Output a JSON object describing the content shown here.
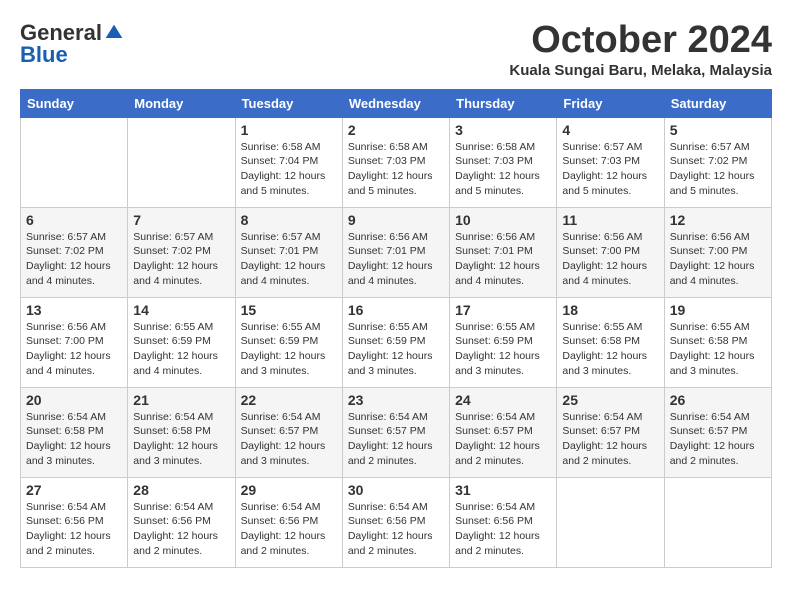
{
  "logo": {
    "general": "General",
    "blue": "Blue"
  },
  "title": "October 2024",
  "subtitle": "Kuala Sungai Baru, Melaka, Malaysia",
  "days_of_week": [
    "Sunday",
    "Monday",
    "Tuesday",
    "Wednesday",
    "Thursday",
    "Friday",
    "Saturday"
  ],
  "weeks": [
    [
      {
        "day": "",
        "detail": ""
      },
      {
        "day": "",
        "detail": ""
      },
      {
        "day": "1",
        "detail": "Sunrise: 6:58 AM\nSunset: 7:04 PM\nDaylight: 12 hours\nand 5 minutes."
      },
      {
        "day": "2",
        "detail": "Sunrise: 6:58 AM\nSunset: 7:03 PM\nDaylight: 12 hours\nand 5 minutes."
      },
      {
        "day": "3",
        "detail": "Sunrise: 6:58 AM\nSunset: 7:03 PM\nDaylight: 12 hours\nand 5 minutes."
      },
      {
        "day": "4",
        "detail": "Sunrise: 6:57 AM\nSunset: 7:03 PM\nDaylight: 12 hours\nand 5 minutes."
      },
      {
        "day": "5",
        "detail": "Sunrise: 6:57 AM\nSunset: 7:02 PM\nDaylight: 12 hours\nand 5 minutes."
      }
    ],
    [
      {
        "day": "6",
        "detail": "Sunrise: 6:57 AM\nSunset: 7:02 PM\nDaylight: 12 hours\nand 4 minutes."
      },
      {
        "day": "7",
        "detail": "Sunrise: 6:57 AM\nSunset: 7:02 PM\nDaylight: 12 hours\nand 4 minutes."
      },
      {
        "day": "8",
        "detail": "Sunrise: 6:57 AM\nSunset: 7:01 PM\nDaylight: 12 hours\nand 4 minutes."
      },
      {
        "day": "9",
        "detail": "Sunrise: 6:56 AM\nSunset: 7:01 PM\nDaylight: 12 hours\nand 4 minutes."
      },
      {
        "day": "10",
        "detail": "Sunrise: 6:56 AM\nSunset: 7:01 PM\nDaylight: 12 hours\nand 4 minutes."
      },
      {
        "day": "11",
        "detail": "Sunrise: 6:56 AM\nSunset: 7:00 PM\nDaylight: 12 hours\nand 4 minutes."
      },
      {
        "day": "12",
        "detail": "Sunrise: 6:56 AM\nSunset: 7:00 PM\nDaylight: 12 hours\nand 4 minutes."
      }
    ],
    [
      {
        "day": "13",
        "detail": "Sunrise: 6:56 AM\nSunset: 7:00 PM\nDaylight: 12 hours\nand 4 minutes."
      },
      {
        "day": "14",
        "detail": "Sunrise: 6:55 AM\nSunset: 6:59 PM\nDaylight: 12 hours\nand 4 minutes."
      },
      {
        "day": "15",
        "detail": "Sunrise: 6:55 AM\nSunset: 6:59 PM\nDaylight: 12 hours\nand 3 minutes."
      },
      {
        "day": "16",
        "detail": "Sunrise: 6:55 AM\nSunset: 6:59 PM\nDaylight: 12 hours\nand 3 minutes."
      },
      {
        "day": "17",
        "detail": "Sunrise: 6:55 AM\nSunset: 6:59 PM\nDaylight: 12 hours\nand 3 minutes."
      },
      {
        "day": "18",
        "detail": "Sunrise: 6:55 AM\nSunset: 6:58 PM\nDaylight: 12 hours\nand 3 minutes."
      },
      {
        "day": "19",
        "detail": "Sunrise: 6:55 AM\nSunset: 6:58 PM\nDaylight: 12 hours\nand 3 minutes."
      }
    ],
    [
      {
        "day": "20",
        "detail": "Sunrise: 6:54 AM\nSunset: 6:58 PM\nDaylight: 12 hours\nand 3 minutes."
      },
      {
        "day": "21",
        "detail": "Sunrise: 6:54 AM\nSunset: 6:58 PM\nDaylight: 12 hours\nand 3 minutes."
      },
      {
        "day": "22",
        "detail": "Sunrise: 6:54 AM\nSunset: 6:57 PM\nDaylight: 12 hours\nand 3 minutes."
      },
      {
        "day": "23",
        "detail": "Sunrise: 6:54 AM\nSunset: 6:57 PM\nDaylight: 12 hours\nand 2 minutes."
      },
      {
        "day": "24",
        "detail": "Sunrise: 6:54 AM\nSunset: 6:57 PM\nDaylight: 12 hours\nand 2 minutes."
      },
      {
        "day": "25",
        "detail": "Sunrise: 6:54 AM\nSunset: 6:57 PM\nDaylight: 12 hours\nand 2 minutes."
      },
      {
        "day": "26",
        "detail": "Sunrise: 6:54 AM\nSunset: 6:57 PM\nDaylight: 12 hours\nand 2 minutes."
      }
    ],
    [
      {
        "day": "27",
        "detail": "Sunrise: 6:54 AM\nSunset: 6:56 PM\nDaylight: 12 hours\nand 2 minutes."
      },
      {
        "day": "28",
        "detail": "Sunrise: 6:54 AM\nSunset: 6:56 PM\nDaylight: 12 hours\nand 2 minutes."
      },
      {
        "day": "29",
        "detail": "Sunrise: 6:54 AM\nSunset: 6:56 PM\nDaylight: 12 hours\nand 2 minutes."
      },
      {
        "day": "30",
        "detail": "Sunrise: 6:54 AM\nSunset: 6:56 PM\nDaylight: 12 hours\nand 2 minutes."
      },
      {
        "day": "31",
        "detail": "Sunrise: 6:54 AM\nSunset: 6:56 PM\nDaylight: 12 hours\nand 2 minutes."
      },
      {
        "day": "",
        "detail": ""
      },
      {
        "day": "",
        "detail": ""
      }
    ]
  ]
}
